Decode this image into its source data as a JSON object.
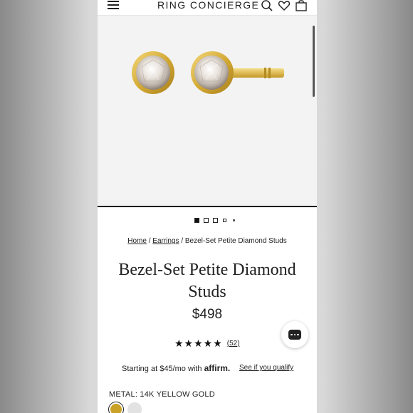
{
  "header": {
    "brand": "RING CONCIERGE",
    "icons": [
      "menu-icon",
      "search-icon",
      "heart-icon",
      "bag-icon"
    ]
  },
  "gallery": {
    "active_index": 0,
    "dot_count": 5
  },
  "breadcrumb": {
    "home": "Home",
    "sep1": "/",
    "category": "Earrings",
    "sep2": "/",
    "current": "Bezel-Set Petite Diamond Studs"
  },
  "product": {
    "title_line1": "Bezel-Set Petite Diamond",
    "title_line2": "Studs",
    "price": "$498",
    "stars": "★★★★★",
    "rating_value": 5,
    "review_count": "(52)"
  },
  "financing": {
    "text": "Starting at $45/mo with",
    "provider": "affirm.",
    "link": "See if you qualify"
  },
  "metal": {
    "label": "METAL:",
    "value": "14K YELLOW GOLD"
  },
  "colors": {
    "gold": "#c9a227",
    "text": "#222222",
    "gallery_bg": "#f3f3f3"
  }
}
